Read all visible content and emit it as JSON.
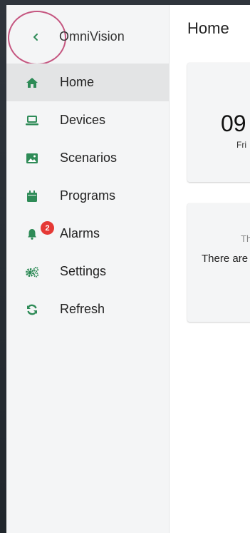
{
  "app": {
    "title": "OmniVision"
  },
  "colors": {
    "accent": "#2e8b57",
    "badge": "#e53935",
    "annotation_ring": "#c55680"
  },
  "sidebar": {
    "back_icon": "chevron-left-icon",
    "items": [
      {
        "label": "Home",
        "icon": "home-icon",
        "active": true
      },
      {
        "label": "Devices",
        "icon": "laptop-icon"
      },
      {
        "label": "Scenarios",
        "icon": "image-icon"
      },
      {
        "label": "Programs",
        "icon": "calendar-icon"
      },
      {
        "label": "Alarms",
        "icon": "bell-icon",
        "badge": "2"
      },
      {
        "label": "Settings",
        "icon": "gears-icon"
      },
      {
        "label": "Refresh",
        "icon": "refresh-icon"
      }
    ]
  },
  "main": {
    "page_title": "Home",
    "clock": {
      "time": "09",
      "date": "Fri"
    },
    "alarms": {
      "title": "Th",
      "text": "There are"
    }
  }
}
